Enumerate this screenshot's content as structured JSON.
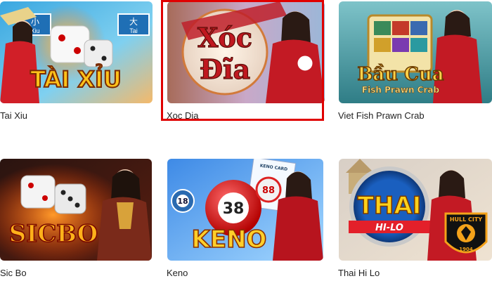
{
  "games": [
    {
      "name": "Tai Xiu",
      "logo": "TÀI XỈU",
      "signs": [
        "小",
        "Xiu",
        "大",
        "Tai"
      ]
    },
    {
      "name": "Xoc Dia",
      "logo_line1": "Xóc",
      "logo_line2": "Đĩa",
      "selected": true
    },
    {
      "name": "Viet Fish Prawn Crab",
      "logo_main": "Bầu Cua",
      "logo_sub": "Fish Prawn Crab"
    },
    {
      "name": "Sic Bo",
      "logo": "SICBO"
    },
    {
      "name": "Keno",
      "logo": "KENO",
      "balls": [
        "18",
        "38",
        "88"
      ],
      "card_label": "KENO CARD"
    },
    {
      "name": "Thai Hi Lo",
      "logo_main": "THAI",
      "logo_sub": "HI-LO",
      "badge_top": "HULL CITY",
      "badge_year": "1904"
    }
  ],
  "colors": {
    "selection_border": "#e00000",
    "label_text": "#1f1f1f"
  }
}
